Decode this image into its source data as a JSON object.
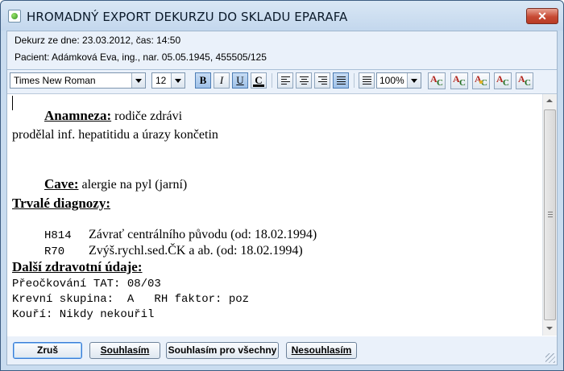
{
  "window": {
    "title": "HROMADNÝ EXPORT DEKURZU DO SKLADU EPARAFA",
    "close_glyph": "✕"
  },
  "info": {
    "line1": "Dekurz ze dne: 23.03.2012, čas: 14:50",
    "line2": "Pacient: Adámková Eva, ing., nar. 05.05.1945, 455505/125"
  },
  "toolbar": {
    "font_family": "Times New Roman",
    "font_size": "12",
    "zoom": "100%",
    "bold_label": "B",
    "italic_label": "I",
    "underline_label": "U",
    "color_label": "C"
  },
  "document": {
    "anamneza_heading": "Anamneza:",
    "anamneza_text": " rodiče zdrávi",
    "anamneza_line2": "prodělal inf. hepatitidu a úrazy končetin",
    "cave_heading": "Cave:",
    "cave_text": " alergie na pyl (jarní)",
    "diagnozy_heading": "Trvalé diagnozy:",
    "diagnozy": [
      {
        "code": "H814",
        "text": "Závrať centrálního původu (od: 18.02.1994)"
      },
      {
        "code": "R70",
        "text": "Zvýš.rychl.sed.ČK a ab. (od: 18.02.1994)"
      }
    ],
    "dalsi_heading": "Další zdravotní údaje:",
    "dalsi_lines": [
      "Přeočkování TAT: 08/03",
      "Krevní skupina:  A   RH faktor: poz",
      "Kouří: Nikdy nekouřil"
    ]
  },
  "buttons": {
    "cancel": "Zruš",
    "agree": "Souhlasím",
    "agree_all": "Souhlasím pro všechny",
    "disagree": "Nesouhlasím"
  }
}
